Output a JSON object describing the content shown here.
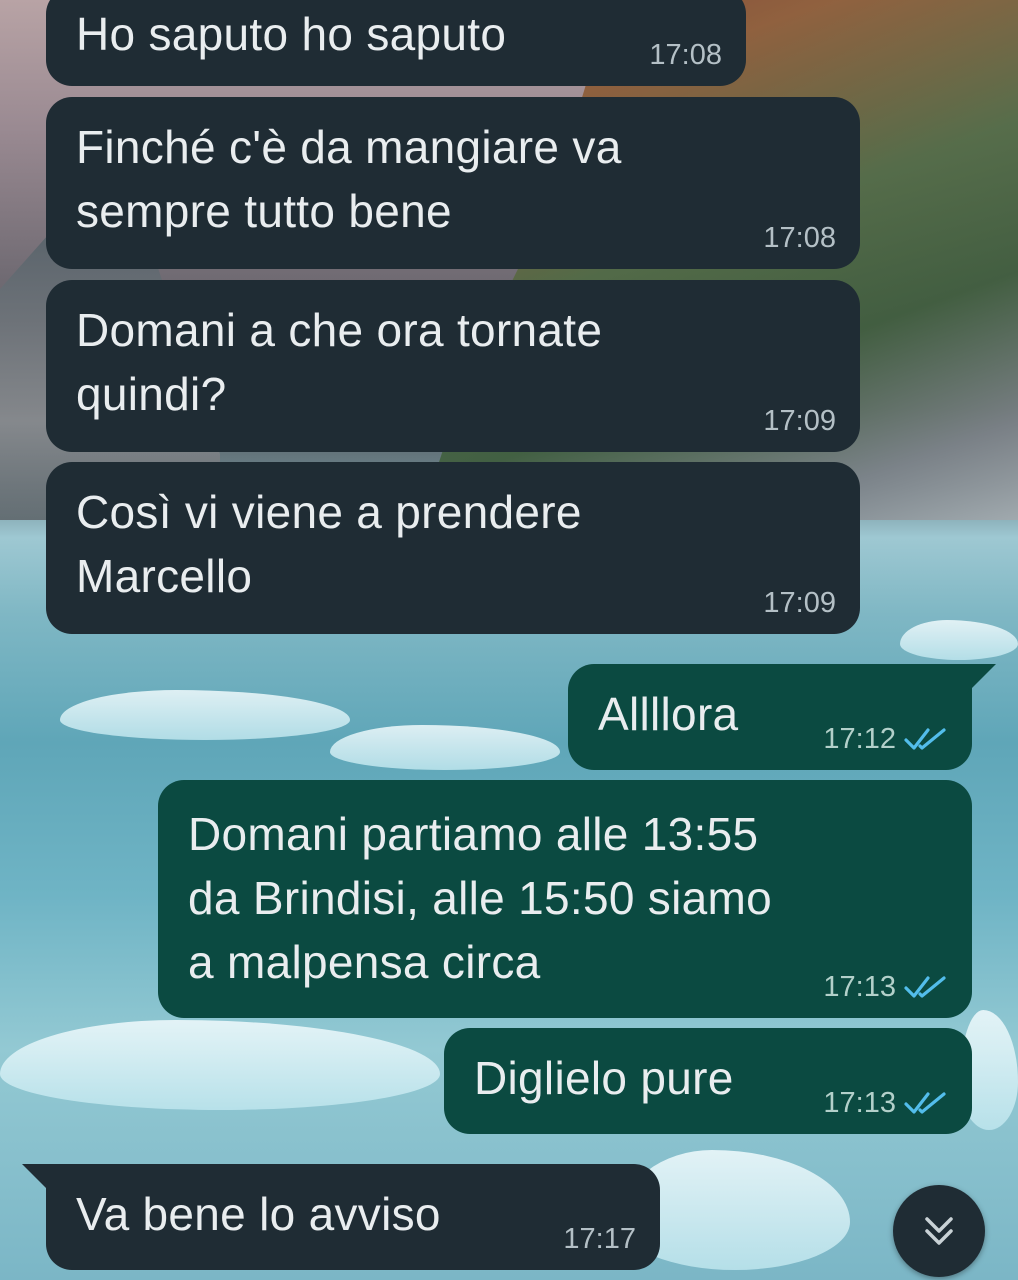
{
  "messages": [
    {
      "side": "in",
      "text": "Ho saputo ho saputo",
      "time": "17:08"
    },
    {
      "side": "in",
      "text": "Finché c'è da mangiare va\nsempre tutto bene",
      "time": "17:08"
    },
    {
      "side": "in",
      "text": "Domani a che ora tornate\nquindi?",
      "time": "17:09"
    },
    {
      "side": "in",
      "text": "Così vi viene a prendere\nMarcello",
      "time": "17:09"
    },
    {
      "side": "out",
      "text": "Allllora",
      "time": "17:12",
      "status": "read"
    },
    {
      "side": "out",
      "text": "Domani partiamo alle 13:55\nda Brindisi, alle 15:50 siamo\na malpensa circa",
      "time": "17:13",
      "status": "read"
    },
    {
      "side": "out",
      "text": "Diglielo pure",
      "time": "17:13",
      "status": "read"
    },
    {
      "side": "in",
      "text": "Va bene lo avviso",
      "time": "17:17"
    }
  ],
  "icons": {
    "read_receipt": "double-check-icon",
    "scroll_down": "chevron-double-down-icon"
  },
  "colors": {
    "incoming_bubble": "#1f2c34",
    "outgoing_bubble": "#0b4a41",
    "read_tick": "#53bdeb",
    "text": "#e9edef"
  }
}
